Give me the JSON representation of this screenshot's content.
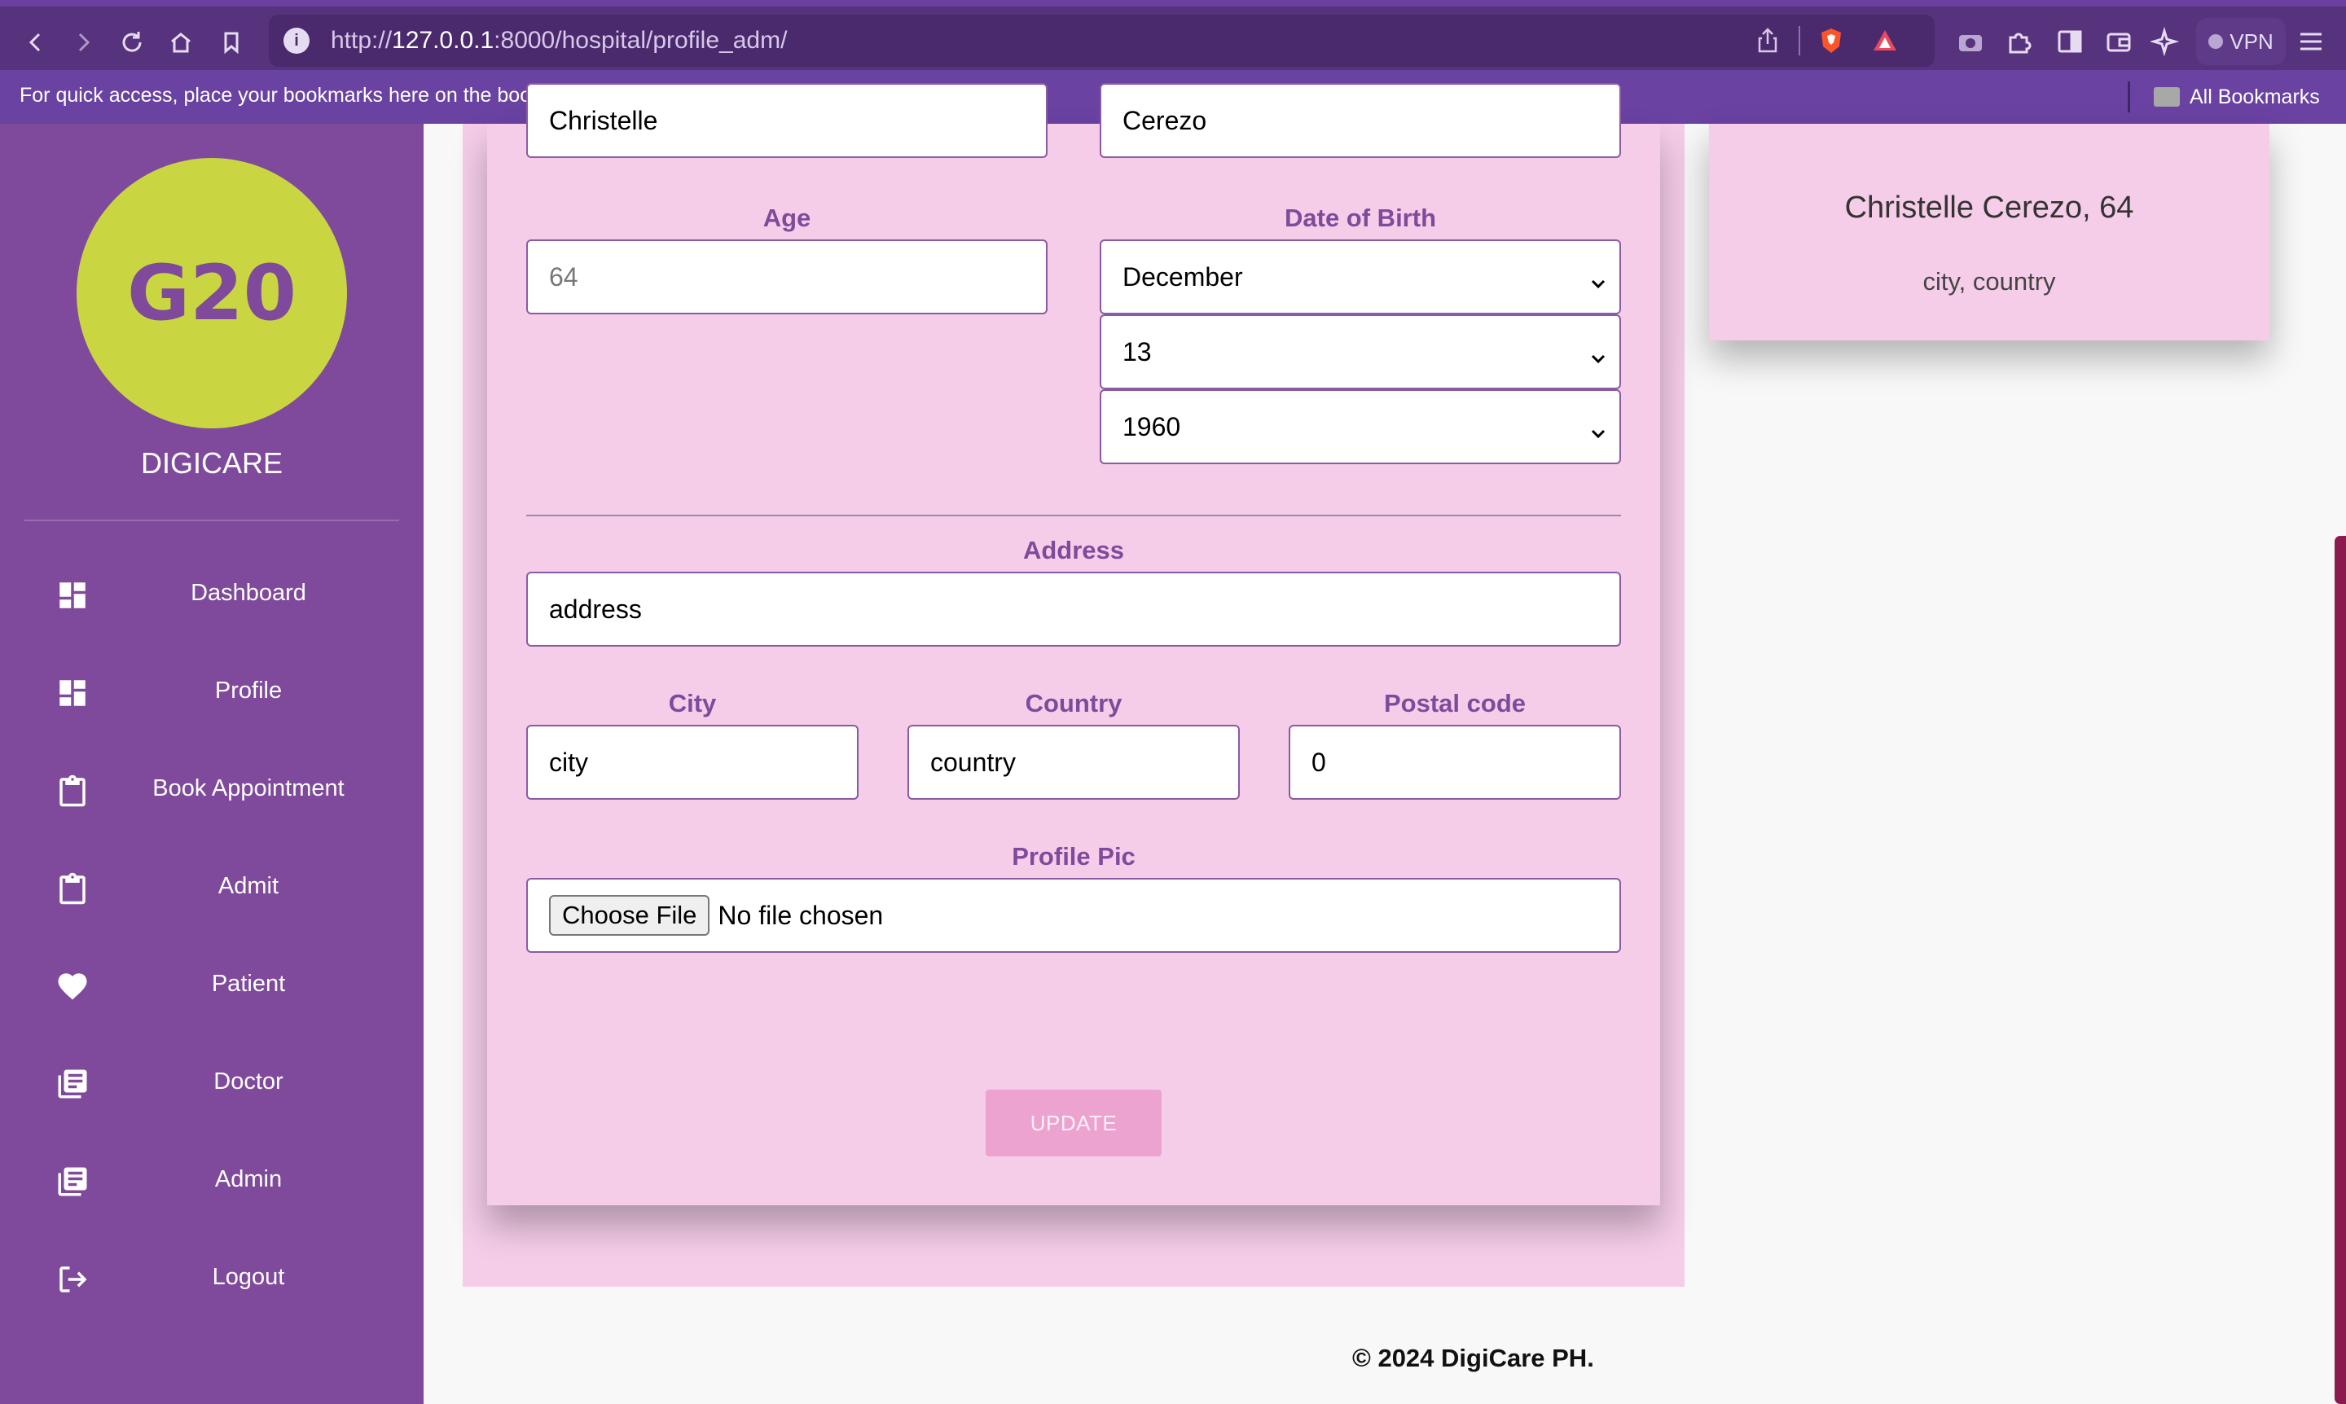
{
  "browser": {
    "url_prefix": "http://",
    "url_host": "127.0.0.1",
    "url_rest": ":8000/hospital/profile_adm/",
    "vpn_label": "VPN",
    "bookmarks_hint": "For quick access, place your bookmarks here on the bookmarks bar.",
    "all_bookmarks": "All Bookmarks"
  },
  "sidebar": {
    "logo_text": "G20",
    "brand": "DIGICARE",
    "items": [
      {
        "label": "Dashboard",
        "icon": "dashboard-icon"
      },
      {
        "label": "Profile",
        "icon": "dashboard-icon"
      },
      {
        "label": "Book Appointment",
        "icon": "clipboard-icon"
      },
      {
        "label": "Admit",
        "icon": "clipboard-icon"
      },
      {
        "label": "Patient",
        "icon": "heart-icon"
      },
      {
        "label": "Doctor",
        "icon": "list-icon"
      },
      {
        "label": "Admin",
        "icon": "list-icon"
      },
      {
        "label": "Logout",
        "icon": "logout-icon"
      }
    ]
  },
  "form": {
    "first_name_value": "Christelle",
    "last_name_value": "Cerezo",
    "age_label": "Age",
    "age_value": "64",
    "dob_label": "Date of Birth",
    "dob_month": "December",
    "dob_day": "13",
    "dob_year": "1960",
    "address_label": "Address",
    "address_value": "address",
    "city_label": "City",
    "city_value": "city",
    "country_label": "Country",
    "country_value": "country",
    "postal_label": "Postal code",
    "postal_value": "0",
    "pic_label": "Profile Pic",
    "choose_file": "Choose File",
    "no_file": "No file chosen",
    "update_button": "UPDATE"
  },
  "profile_card": {
    "name_age": "Christelle Cerezo, 64",
    "location": "city, country"
  },
  "footer": {
    "text": "© 2024 DigiCare PH."
  },
  "colors": {
    "sidebar": "#7f4a9b",
    "logo": "#c9d642",
    "card": "#f5cde9",
    "label": "#7f4a9b",
    "update_button": "#eda3cf"
  }
}
